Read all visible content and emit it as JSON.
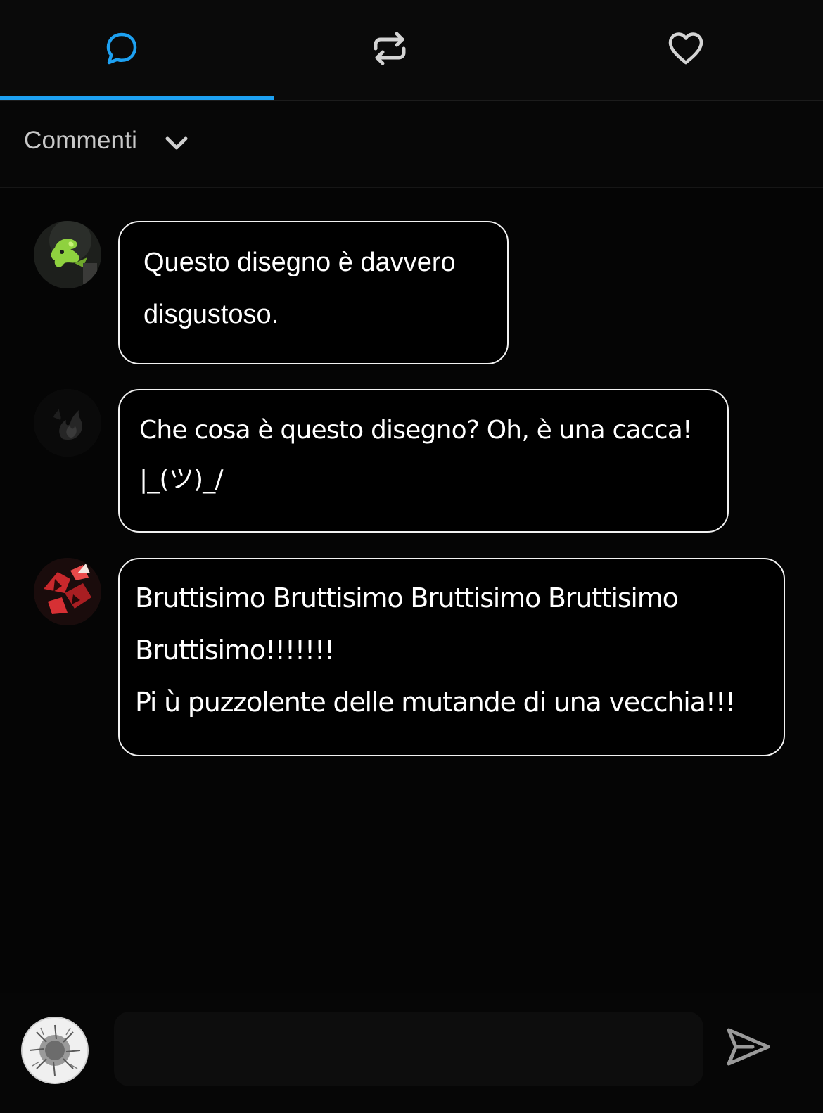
{
  "tabs": [
    {
      "id": "comments",
      "icon": "comment-icon",
      "active": true
    },
    {
      "id": "reposts",
      "icon": "repost-icon",
      "active": false
    },
    {
      "id": "likes",
      "icon": "heart-icon",
      "active": false
    }
  ],
  "colors": {
    "accent": "#1da1f2",
    "background": "#050505",
    "bubble_border": "#f2f2f2",
    "muted_text": "#c9c9c9",
    "icon_gray": "#d4d4d4"
  },
  "section": {
    "title": "Commenti",
    "toggle_icon": "chevron-down-icon"
  },
  "comments": [
    {
      "avatar": "avatar-green-creature",
      "text": "Questo disegno è davvero\ndisgustoso."
    },
    {
      "avatar": "avatar-dark-flame",
      "text": "Che cosa è questo disegno? Oh, è una cacca!\n|_(ツ)_/"
    },
    {
      "avatar": "avatar-red-pattern",
      "text": "Bruttisimo Bruttisimo Bruttisimo Bruttisimo\nBruttisimo!!!!!!!\nPi ù puzzolente delle mutande di una vecchia!!!"
    }
  ],
  "composer": {
    "avatar": "avatar-current-user",
    "input_value": "",
    "input_placeholder": "",
    "send_icon": "send-icon"
  }
}
